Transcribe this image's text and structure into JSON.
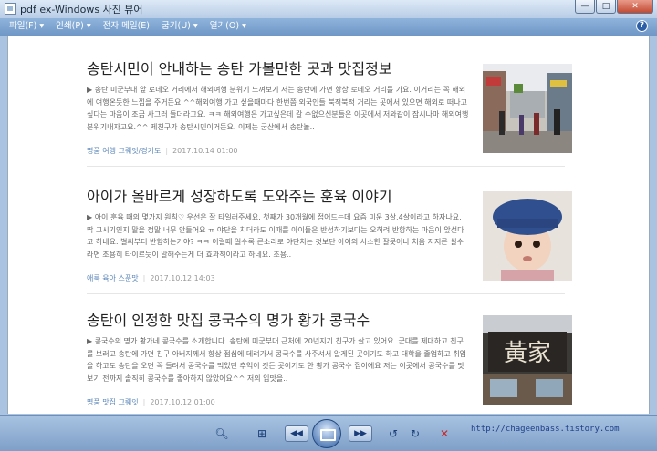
{
  "window": {
    "title": "pdf ex-Windows 사진 뷰어",
    "min_label": "—",
    "max_label": "□",
    "close_label": "✕"
  },
  "menu": {
    "items": [
      "파일(F)",
      "인쇄(P)",
      "전자 메일(E)",
      "굽기(U)",
      "열기(O)"
    ],
    "dropdown_glyph": "▾",
    "help_label": "?"
  },
  "posts": [
    {
      "title": "송탄시민이 안내하는 송탄 가볼만한 곳과 맛집정보",
      "body": "▶ 송탄 미군부대 앞 로데오 거리에서 해외여행 분위기 느껴보기  저는 송탄에 가면 항상 로데오 거리를 가요. 이거리는 꼭 해외에 여행온듯한 느낌을 주거든요.^^해외여행 가고 싶을때마다 한번쯤 외국인들 북적북적 거리는 곳에서 있으면 해외로 떠나고 싶다는 마음이 조금 사그러 들더라고요. ㅋㅋ 해외여행은 가고싶은데 갈 수없으신분들은 이곳에서 저와같이 잠시나마 해외여행 분위기내자고요.^^  제친구가 송탄시민이거든요. 이제는 군산에서 송탄놀..",
      "category": "명품 여행 그뤠잇/경기도",
      "date": "2017.10.14 01:00"
    },
    {
      "title": "아이가 올바르게 성장하도록 도와주는 훈육 이야기",
      "body": "▶ 아이 훈육 때의 몇가지 원칙♡ 우선은 잘 타일러주세요. 첫째가 30개월에 접어드는데 요즘 미운 3살,4살이라고 하자나요. 딱 그시기인지 말을 정말 너무 안들어요 ㅠ 야단을 치더라도 이때를 아이들은 반성하기보다는 오히려 반항하는 마음이 앞선다고 하네요. 벌써부터 반항하는거야? ㅋㅋ 이럴때 일수록 큰소리로 야단치는 것보단 아이의 사소한 잘못이나 처음 저지른 실수라면 조용히 타이르듯이 말해주는게 더 효과적이라고 하네요. 조용..",
      "category": "애룩 육아 스푼맛",
      "date": "2017.10.12 14:03"
    },
    {
      "title": "송탄이 인정한 맛집 콩국수의 명가 황가 콩국수",
      "body": "▶ 콩국수의 명가 황가네 콩국수를 소개합니다. 송탄에 미군부대 근처에 20년지기 친구가 살고 있어요. 군대를 제대하고 친구를 보러고 송탄에 가면 친구 아버지께서 항상 점심에 데려가서 콩국수를 사주셔서 알게된 곳이기도 하고 대학을 졸업하고 취업을 하고도 송탄을 오면 꼭 들려서 콩국수를 먹었던 추억이 깃든 곳이기도 한 황가 콩국수 집이에요 저는 이곳에서 콩국수를 맛보기 전까지 솔직히 콩국수를 좋아하지 않았어요^^ 저의 입맛을..",
      "category": "명품 맛집 그뤠잇",
      "date": "2017.10.12 01:00",
      "sign_text": "黃家"
    }
  ],
  "toolbar": {
    "zoom_glyph": "🔍︎",
    "fit_glyph": "⊞",
    "prev_glyph": "◀◀",
    "next_glyph": "▶▶",
    "rotate_ccw_glyph": "↺",
    "rotate_cw_glyph": "↻",
    "delete_glyph": "✕",
    "url": "http://chageenbass.tistory.com"
  },
  "colors": {
    "accent": "#5b86b8",
    "delete_red": "#c8282a"
  }
}
